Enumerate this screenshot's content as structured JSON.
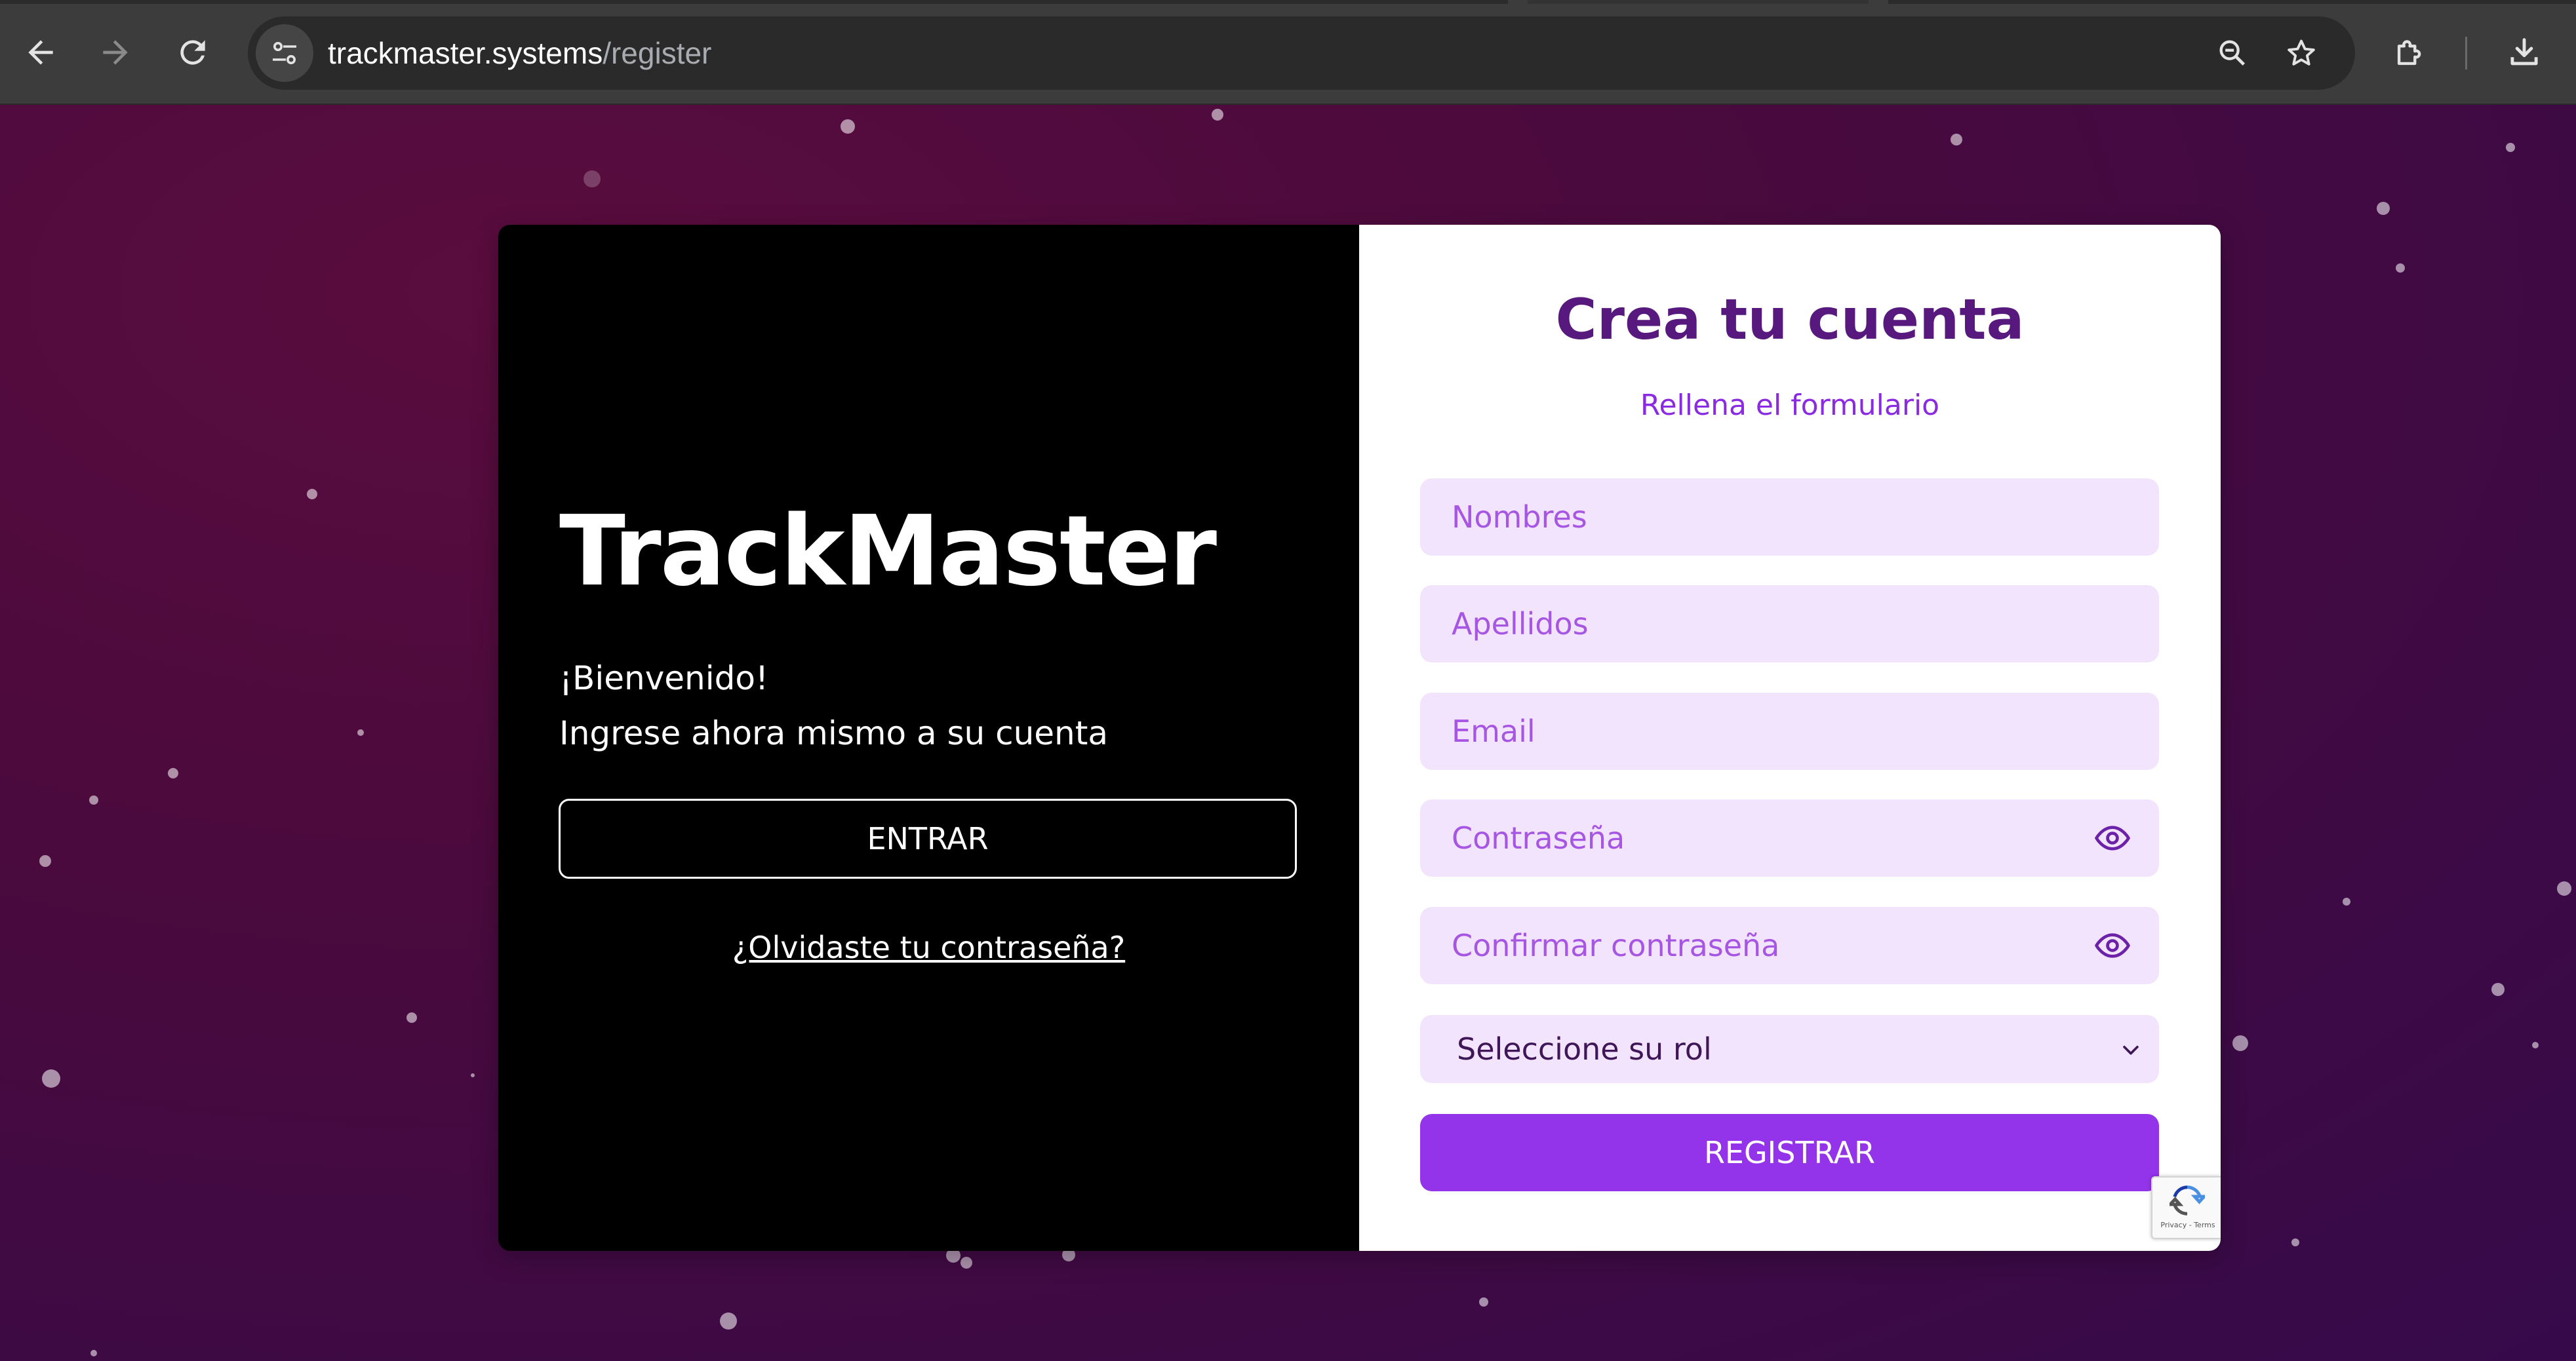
{
  "browser": {
    "url_host": "trackmaster.systems",
    "url_path": "/register",
    "icons": {
      "back": "arrow-left-icon",
      "forward": "arrow-right-icon",
      "reload": "reload-icon",
      "site_info": "tune-icon",
      "zoom": "zoom-out-icon",
      "bookmark": "star-icon",
      "extensions": "puzzle-icon",
      "downloads": "download-icon"
    }
  },
  "left": {
    "brand": "TrackMaster",
    "welcome_line1": "¡Bienvenido!",
    "welcome_line2": "Ingrese ahora mismo a su cuenta",
    "enter_label": "ENTRAR",
    "forgot_label": "¿Olvidaste tu contraseña?"
  },
  "form": {
    "title": "Crea tu cuenta",
    "subtitle": "Rellena el formulario",
    "first_name": {
      "placeholder": "Nombres",
      "value": ""
    },
    "last_name": {
      "placeholder": "Apellidos",
      "value": ""
    },
    "email": {
      "placeholder": "Email",
      "value": ""
    },
    "password": {
      "placeholder": "Contraseña",
      "value": ""
    },
    "confirm_password": {
      "placeholder": "Confirmar contraseña",
      "value": ""
    },
    "role_select": {
      "selected": "Seleccione su rol"
    },
    "register_label": "REGISTRAR",
    "recaptcha_links": "Privacy - Terms"
  },
  "colors": {
    "title": "#58197f",
    "subtitle": "#8a2be2",
    "field_bg": "#f2e4fd",
    "placeholder": "#a755e3",
    "register_button": "#9333ea",
    "left_panel": "#000000"
  }
}
